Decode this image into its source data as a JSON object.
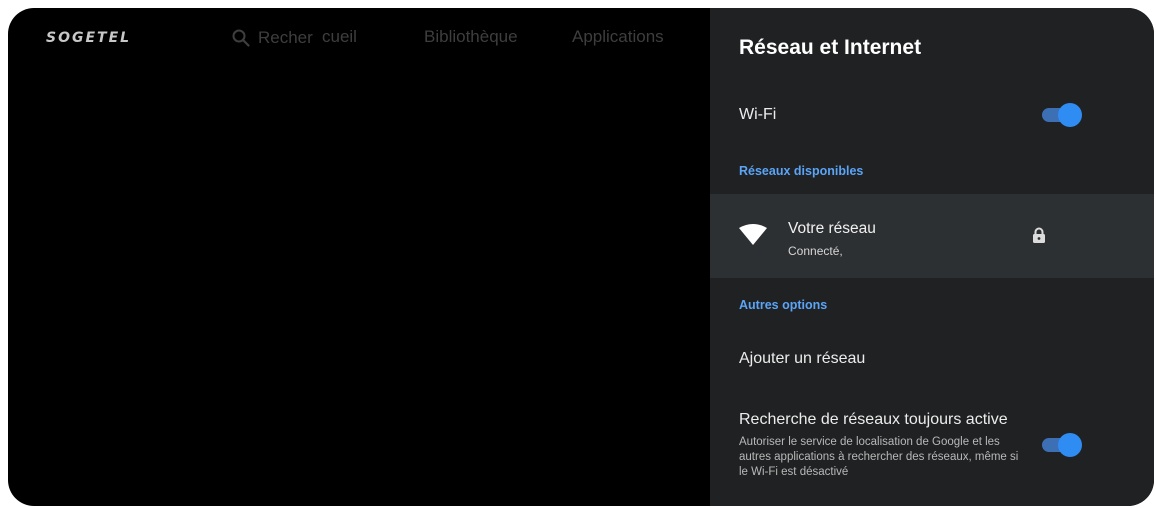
{
  "nav": {
    "logo": "SOGETEL",
    "search_label": "Recher",
    "items": [
      "cueil",
      "Bibliothèque",
      "Applications"
    ]
  },
  "panel": {
    "title": "Réseau et Internet",
    "wifi": {
      "label": "Wi-Fi",
      "enabled": true
    },
    "available_networks_label": "Réseaux disponibles",
    "network": {
      "name": "Votre réseau",
      "status": "Connecté,",
      "secured": true
    },
    "other_options_label": "Autres options",
    "add_network_label": "Ajouter un réseau",
    "scanning": {
      "label": "Recherche de réseaux toujours active",
      "description": "Autoriser le service de localisation de Google et les autres applications à rechercher des réseaux, même si le Wi-Fi est désactivé",
      "enabled": true
    }
  },
  "colors": {
    "accent": "#5ba4f6",
    "toggle_on": "#2f8cf3",
    "panel_bg": "#1f2123",
    "selected_row_bg": "#2d3032"
  }
}
